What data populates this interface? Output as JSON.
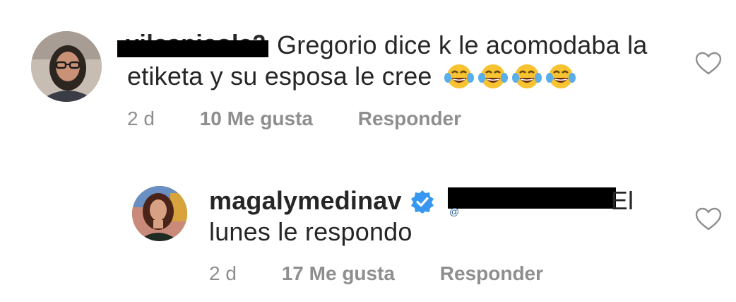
{
  "comments": [
    {
      "username": "vilcanicole2",
      "text": "Gregorio dice k le acomodaba la etiketa y su esposa le cree",
      "emojis": [
        "face-with-tears-of-joy",
        "face-with-tears-of-joy",
        "face-with-tears-of-joy",
        "face-with-tears-of-joy"
      ],
      "time": "2 d",
      "likes": "10 Me gusta",
      "reply": "Responder",
      "avatar_icon": "user-avatar",
      "like_icon": "heart-outline-icon"
    },
    {
      "username": "magalymedinav",
      "verified": true,
      "mention_peek": "@",
      "text": "El lunes le respondo",
      "time": "2 d",
      "likes": "17 Me gusta",
      "reply": "Responder",
      "avatar_icon": "user-avatar",
      "like_icon": "heart-outline-icon"
    }
  ],
  "colors": {
    "text": "#262626",
    "meta": "#8e8e8e",
    "verified_badge": "#3897f0",
    "redaction": "#000000",
    "emoji_face": "#f8c330",
    "emoji_tears": "#5aaeea"
  }
}
